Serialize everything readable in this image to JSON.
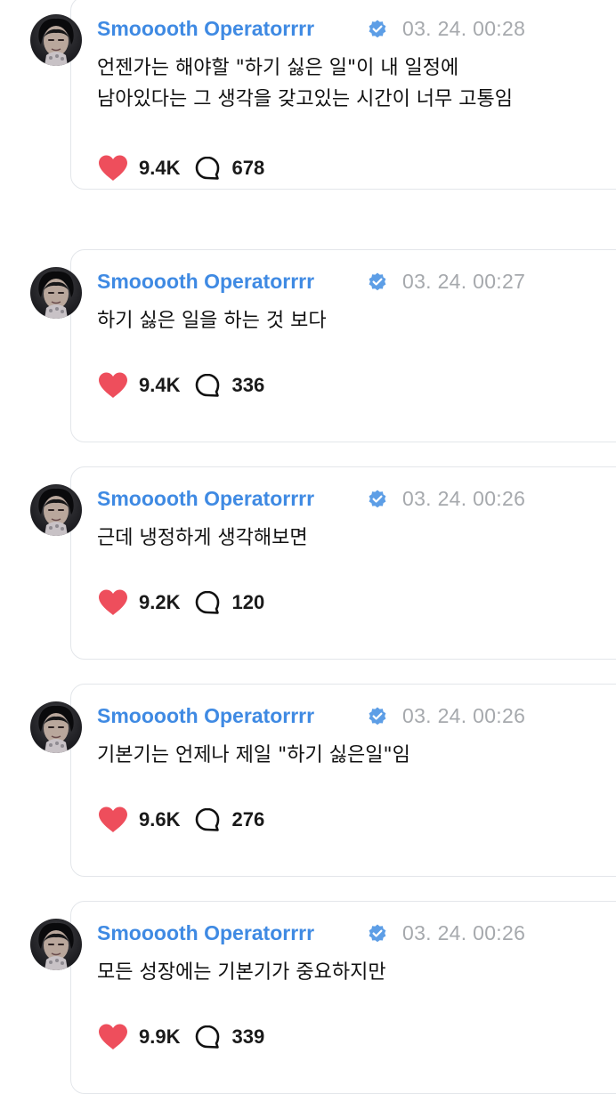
{
  "colors": {
    "name": "#3f8ae3",
    "verified_badge": "#5d9ee6",
    "timestamp": "#a6a9ad",
    "heart": "#ee4e5c",
    "card_border": "#e3e6ea"
  },
  "posts": [
    {
      "author": "Smooooth Operatorrrr",
      "timestamp": "03. 24. 00:28",
      "text": "언젠가는 해야할 \"하기 싫은 일\"이 내 일정에\n남아있다는 그 생각을 갖고있는 시간이 너무 고통임",
      "likes": "9.4K",
      "comments": "678"
    },
    {
      "author": "Smooooth Operatorrrr",
      "timestamp": "03. 24. 00:27",
      "text": "하기 싫은 일을 하는 것 보다",
      "likes": "9.4K",
      "comments": "336"
    },
    {
      "author": "Smooooth Operatorrrr",
      "timestamp": "03. 24. 00:26",
      "text": "근데 냉정하게 생각해보면",
      "likes": "9.2K",
      "comments": "120"
    },
    {
      "author": "Smooooth Operatorrrr",
      "timestamp": "03. 24. 00:26",
      "text": "기본기는 언제나 제일 \"하기 싫은일\"임",
      "likes": "9.6K",
      "comments": "276"
    },
    {
      "author": "Smooooth Operatorrrr",
      "timestamp": "03. 24. 00:26",
      "text": "모든 성장에는 기본기가 중요하지만",
      "likes": "9.9K",
      "comments": "339"
    }
  ]
}
